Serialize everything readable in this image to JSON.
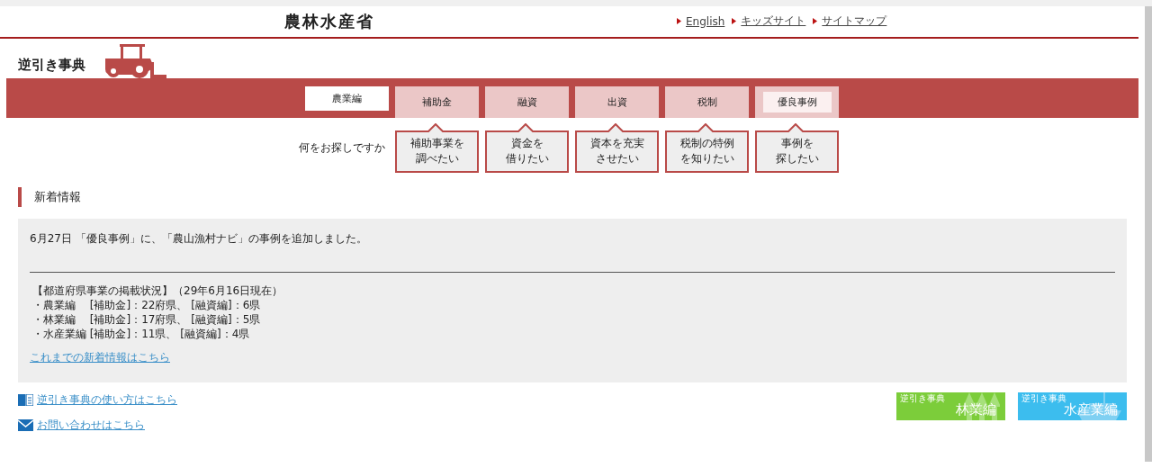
{
  "header": {
    "logo": "農林水産省",
    "links": [
      "English",
      "キッズサイト",
      "サイトマップ"
    ]
  },
  "site_title": "逆引き事典",
  "tabs": [
    {
      "label": "農業編",
      "selected": true,
      "highlighted": false
    },
    {
      "label": "補助金",
      "selected": false,
      "highlighted": false
    },
    {
      "label": "融資",
      "selected": false,
      "highlighted": false
    },
    {
      "label": "出資",
      "selected": false,
      "highlighted": false
    },
    {
      "label": "税制",
      "selected": false,
      "highlighted": false
    },
    {
      "label": "優良事例",
      "selected": false,
      "highlighted": true
    }
  ],
  "question": "何をお探しですか",
  "callouts": [
    [
      "補助事業を",
      "調べたい"
    ],
    [
      "資金を",
      "借りたい"
    ],
    [
      "資本を充実",
      "させたい"
    ],
    [
      "税制の特例",
      "を知りたい"
    ],
    [
      "事例を",
      "探したい"
    ]
  ],
  "news": {
    "heading": "新着情報",
    "item": "6月27日 「優良事例」に、「農山漁村ナビ」の事例を追加しました。",
    "status_lines": [
      "【都道府県事業の掲載状況】（29年6月16日現在）",
      "・農業編　 [補助金]：22府県、 [融資編]：6県",
      "・林業編　 [補助金]：17府県、 [融資編]：5県",
      "・水産業編 [補助金]：11県、 [融資編]：4県"
    ],
    "archive_link": "これまでの新着情報はこちら"
  },
  "footer_links": [
    {
      "kind": "guide",
      "label": "逆引き事典の使い方はこちら"
    },
    {
      "kind": "contact",
      "label": "お問い合わせはこちら"
    }
  ],
  "banners": [
    {
      "kind": "forestry",
      "caption": "逆引き事典",
      "title": "林業編"
    },
    {
      "kind": "fishery",
      "caption": "逆引き事典",
      "title": "水産業編"
    }
  ]
}
